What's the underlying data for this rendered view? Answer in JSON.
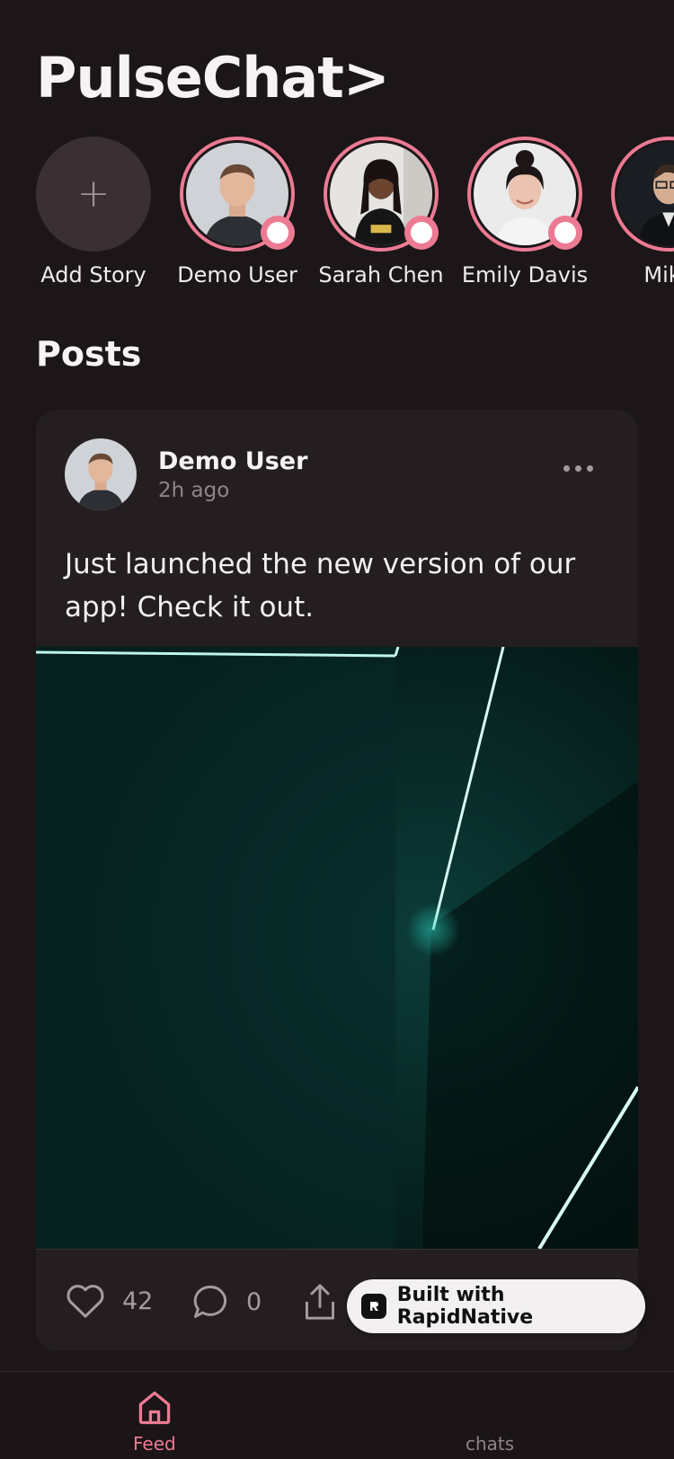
{
  "app": {
    "title": "PulseChat>"
  },
  "stories": {
    "add_label": "Add Story",
    "items": [
      {
        "name": "Demo User"
      },
      {
        "name": "Sarah Chen"
      },
      {
        "name": "Emily Davis"
      },
      {
        "name": "Mike"
      }
    ]
  },
  "posts_section": {
    "title": "Posts"
  },
  "post": {
    "author": "Demo User",
    "time": "2h ago",
    "text": "Just launched the new version of our app! Check it out.",
    "likes": "42",
    "comments": "0"
  },
  "badge": {
    "text": "Built with RapidNative"
  },
  "tabs": [
    {
      "label": "Feed",
      "active": true
    },
    {
      "label": "chats",
      "active": false
    }
  ],
  "colors": {
    "accent": "#ec7a93",
    "background": "#1c1618",
    "card": "#251e21"
  }
}
